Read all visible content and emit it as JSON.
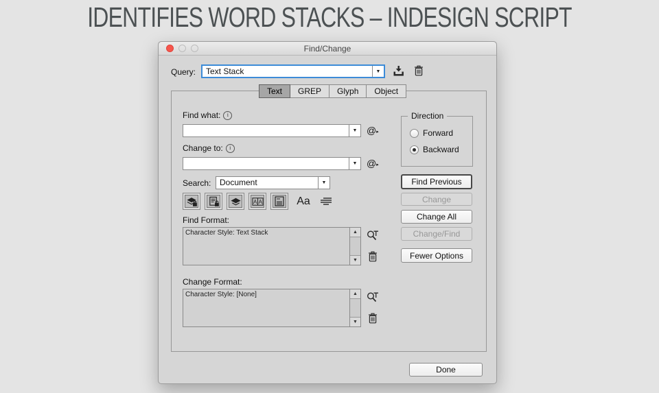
{
  "page": {
    "heading": "IDENTIFIES WORD STACKS – INDESIGN SCRIPT"
  },
  "window": {
    "title": "Find/Change"
  },
  "query": {
    "label": "Query:",
    "value": "Text Stack"
  },
  "tabs": [
    {
      "label": "Text",
      "selected": true
    },
    {
      "label": "GREP",
      "selected": false
    },
    {
      "label": "Glyph",
      "selected": false
    },
    {
      "label": "Object",
      "selected": false
    }
  ],
  "fields": {
    "find_what": {
      "label": "Find what:",
      "value": ""
    },
    "change_to": {
      "label": "Change to:",
      "value": ""
    },
    "search": {
      "label": "Search:",
      "value": "Document"
    }
  },
  "find_format": {
    "label": "Find Format:",
    "value": "Character Style: Text Stack"
  },
  "change_format": {
    "label": "Change Format:",
    "value": "Character Style: [None]"
  },
  "direction": {
    "legend": "Direction",
    "options": [
      {
        "label": "Forward",
        "selected": false
      },
      {
        "label": "Backward",
        "selected": true
      }
    ]
  },
  "action_buttons": [
    {
      "label": "Find Previous",
      "enabled": true,
      "default": true
    },
    {
      "label": "Change",
      "enabled": false,
      "default": false
    },
    {
      "label": "Change All",
      "enabled": true,
      "default": false
    },
    {
      "label": "Change/Find",
      "enabled": false,
      "default": false
    },
    {
      "label": "Fewer Options",
      "enabled": true,
      "default": false
    }
  ],
  "done": {
    "label": "Done"
  },
  "icons": {
    "combo_arrow": "▼",
    "scroll_up": "▲",
    "scroll_down": "▼",
    "at_symbol": "@",
    "flyout_arrow": "▸",
    "info_glyph": "i",
    "case_sensitive_glyph": "Aa",
    "search_option_names": [
      "include-locked-layers",
      "include-locked-stories",
      "include-hidden-layers",
      "include-master-pages",
      "include-footnotes",
      "case-sensitive",
      "whole-word"
    ]
  },
  "colors": {
    "page_bg": "#e4e4e4",
    "dialog_bg": "#d6d6d6",
    "heading_text": "#4c5153",
    "focus_blue": "#3c8bd8",
    "close_red": "#f6564d"
  }
}
